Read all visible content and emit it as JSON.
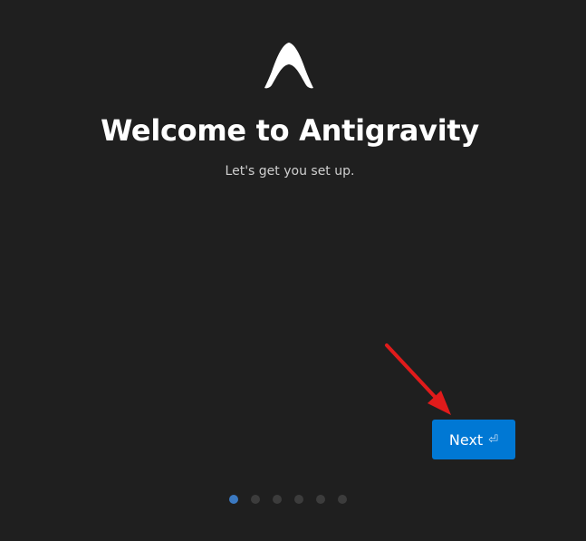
{
  "welcome": {
    "title": "Welcome to Antigravity",
    "subtitle": "Let's get you set up."
  },
  "next_button": {
    "label": "Next",
    "icon": "enter-icon",
    "icon_glyph": "⏎"
  },
  "pagination": {
    "total_steps": 6,
    "current_step": 1
  },
  "annotation": {
    "arrow_color": "#e01b1b"
  },
  "colors": {
    "background": "#1f1f1f",
    "accent": "#0078d4",
    "dot_active": "#3b79c1",
    "dot_inactive": "#3c3c3c"
  }
}
